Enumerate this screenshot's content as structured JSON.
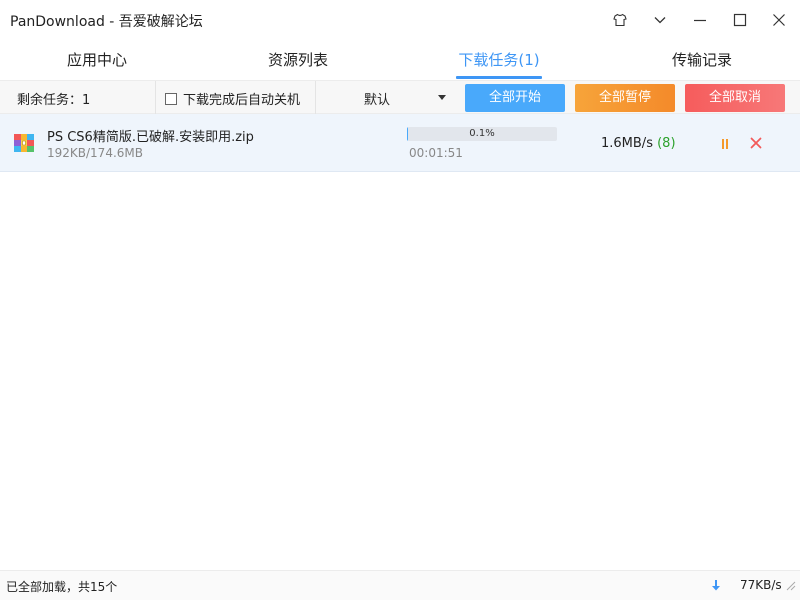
{
  "window": {
    "title": "PanDownload - 吾爱破解论坛",
    "controls": [
      "shirt-icon",
      "chevron-down-icon",
      "minimize-icon",
      "maximize-icon",
      "close-icon"
    ]
  },
  "tabs": [
    {
      "label": "应用中心"
    },
    {
      "label": "资源列表"
    },
    {
      "label": "下载任务(1)",
      "active": true
    },
    {
      "label": "传输记录"
    }
  ],
  "toolbar": {
    "remaining_label": "剩余任务：1",
    "auto_shutdown_label": "下载完成后自动关机",
    "auto_shutdown_checked": false,
    "dropdown_value": "默认",
    "start_all_label": "全部开始",
    "pause_all_label": "全部暂停",
    "cancel_all_label": "全部取消"
  },
  "tasks": [
    {
      "file_name": "PS CS6精简版.已破解.安装即用.zip",
      "size_progress": "192KB/174.6MB",
      "progress_percent": 0.1,
      "progress_label": "0.1%",
      "elapsed": "00:01:51",
      "speed": "1.6MB/s",
      "connections": "(8)",
      "icon": "archive-zip-icon"
    }
  ],
  "statusbar": {
    "text": "已全部加载，共15个",
    "download_speed": "77KB/s"
  },
  "colors": {
    "accent": "#3e96f5",
    "start_button": "#49a9fb",
    "pause_button": "#f48a2a",
    "cancel_button": "#f65c5c",
    "row_bg": "#eff5fc",
    "connections": "#2ca22c"
  }
}
